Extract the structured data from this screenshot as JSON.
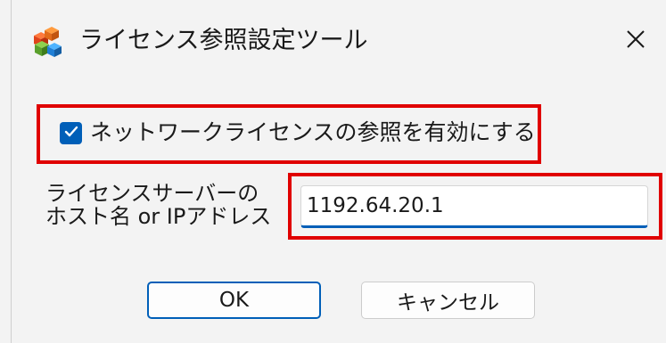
{
  "window": {
    "title": "ライセンス参照設定ツール",
    "app_icon": "app-cubes-icon",
    "close_icon": "close-icon"
  },
  "network_license": {
    "checkbox_checked": true,
    "checkbox_label": "ネットワークライセンスの参照を有効にする"
  },
  "host": {
    "label_line1": "ライセンスサーバーの",
    "label_line2": "ホスト名 or IPアドレス",
    "value": "1192.64.20.1"
  },
  "buttons": {
    "ok_label": "OK",
    "cancel_label": "キャンセル"
  },
  "colors": {
    "accent": "#005fb8",
    "highlight_border": "#e00000",
    "window_bg": "#f3f3f3"
  }
}
